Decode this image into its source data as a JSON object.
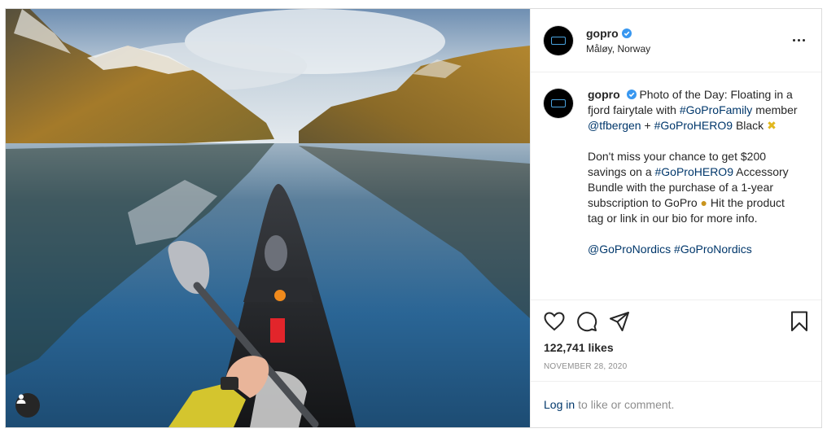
{
  "post": {
    "username": "gopro",
    "location": "Måløy, Norway",
    "caption": {
      "username": "gopro",
      "line1_prefix": "Photo of the Day: Floating in a fjord fairytale with",
      "tag_family": "#GoProFamily",
      "member_word": "member",
      "mention_tfbergen": "@tfbergen",
      "plus": "+",
      "tag_hero9": "#GoProHERO9",
      "black_word": "Black",
      "para2_prefix": "Don't miss your chance to get $200 savings on a",
      "tag_hero9_b": "#GoProHERO9",
      "para2_mid": "Accessory Bundle with the purchase of a 1-year subscription to GoPro",
      "para2_suffix": "Hit the product tag or link in our bio for more info.",
      "mention_nordics": "@GoProNordics",
      "tag_nordics": "#GoProNordics"
    },
    "likes": "122,741 likes",
    "date": "November 28, 2020",
    "login_link": "Log in",
    "login_suffix": "to like or comment."
  },
  "colors": {
    "link": "#00376b",
    "verified": "#3897f0",
    "muted": "#8e8e8e"
  },
  "icons": [
    "user-tag-icon",
    "verified-badge-icon",
    "more-options-icon",
    "like-heart-icon",
    "comment-icon",
    "share-icon",
    "save-bookmark-icon"
  ]
}
